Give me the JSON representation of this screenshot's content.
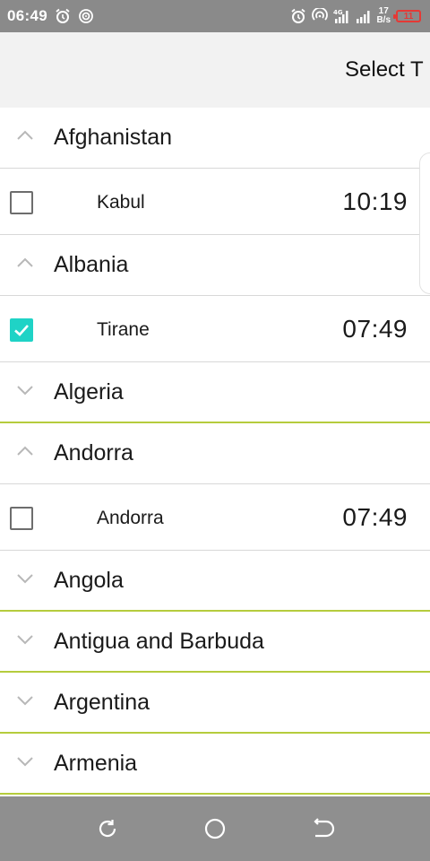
{
  "status_bar": {
    "time": "06:49",
    "left_icons": [
      "alarm-icon",
      "hotspot-icon"
    ],
    "right_icons": [
      "alarm-icon",
      "hotspot-icon",
      "signal-4g-icon",
      "signal-icon"
    ],
    "net_speed_value": "17",
    "net_speed_unit": "B/s",
    "battery_level": "11",
    "battery_color": "#e53935"
  },
  "header": {
    "title": "Select T"
  },
  "colors": {
    "accent_divider": "#b5cc3d",
    "checkbox_checked": "#1fd3c6"
  },
  "list": {
    "groups": [
      {
        "country": "Afghanistan",
        "expanded": true,
        "cities": [
          {
            "name": "Kabul",
            "time": "10:19",
            "checked": false
          }
        ]
      },
      {
        "country": "Albania",
        "expanded": true,
        "cities": [
          {
            "name": "Tirane",
            "time": "07:49",
            "checked": true
          }
        ]
      },
      {
        "country": "Algeria",
        "expanded": false,
        "cities": []
      },
      {
        "country": "Andorra",
        "expanded": true,
        "cities": [
          {
            "name": "Andorra",
            "time": "07:49",
            "checked": false
          }
        ]
      },
      {
        "country": "Angola",
        "expanded": false,
        "cities": []
      },
      {
        "country": "Antigua and Barbuda",
        "expanded": false,
        "cities": []
      },
      {
        "country": "Argentina",
        "expanded": false,
        "cities": []
      },
      {
        "country": "Armenia",
        "expanded": false,
        "cities": []
      }
    ]
  },
  "nav_bar": {
    "buttons": [
      "recent-apps-icon",
      "home-icon",
      "back-icon"
    ]
  }
}
